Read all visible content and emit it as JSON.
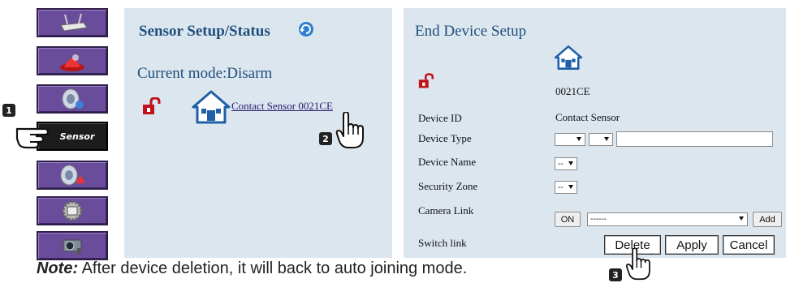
{
  "nav": {
    "items": [
      {
        "icon": "router-icon"
      },
      {
        "icon": "alarm-siren-icon"
      },
      {
        "icon": "speaker-icon"
      },
      {
        "label": "Sensor",
        "icon": "sensor-icon",
        "active": true
      },
      {
        "icon": "speaker-alert-icon"
      },
      {
        "icon": "settings-gear-icon"
      },
      {
        "icon": "camera-icon"
      }
    ]
  },
  "steps": {
    "one": "1",
    "two": "2",
    "three": "3"
  },
  "sensor_panel": {
    "title": "Sensor Setup/Status",
    "mode": "Current mode:Disarm",
    "device_link": "Contact Sensor 0021CE"
  },
  "end_device": {
    "title": "End Device Setup",
    "device_code": "0021CE",
    "rows": {
      "device_id": {
        "label": "Device ID",
        "value": "Contact Sensor"
      },
      "device_type": {
        "label": "Device Type"
      },
      "device_name": {
        "label": "Device Name",
        "value": "--"
      },
      "security_zone": {
        "label": "Security Zone",
        "value": "--"
      },
      "camera_link": {
        "label": "Camera Link",
        "on_label": "ON",
        "select_value": "------",
        "add_label": "Add"
      },
      "switch_link": {
        "label": "Switch link"
      }
    },
    "buttons": {
      "delete": "Delete",
      "apply": "Apply",
      "cancel": "Cancel"
    }
  },
  "note": {
    "prefix": "Note:",
    "text": " After device deletion, it will back to auto joining mode."
  },
  "colors": {
    "nav_purple": "#6a4d9a",
    "panel_bg": "#dce6ef",
    "title_blue": "#1e4f7c",
    "lock_red": "#c0121a",
    "house_blue": "#1f5fa8"
  }
}
